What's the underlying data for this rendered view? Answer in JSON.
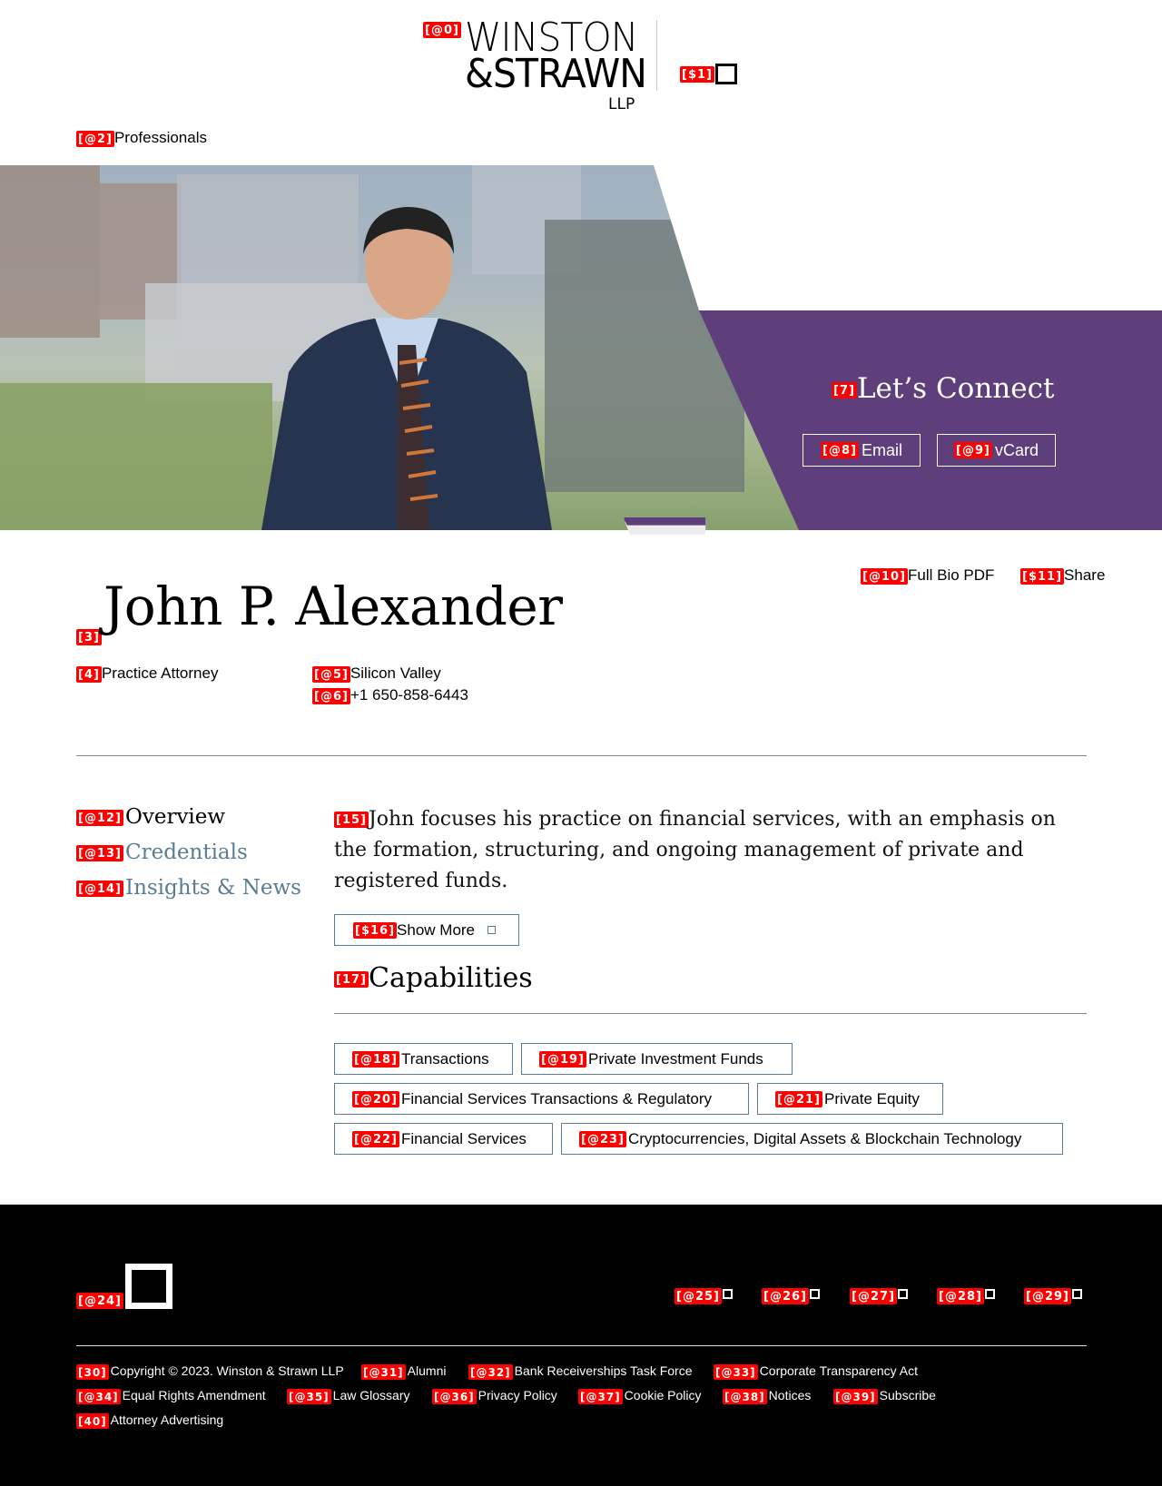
{
  "header": {
    "logo_tag": "[@0]",
    "logo_line1": "WINSTON",
    "logo_line2": "&STRAWN",
    "logo_line3": "LLP",
    "menu_tag": "[$1]"
  },
  "breadcrumb": {
    "tag": "[@2]",
    "label": "Professionals"
  },
  "connect": {
    "title_tag": "[7]",
    "title": "Let’s Connect",
    "email_tag": "[@8]",
    "email_label": "Email",
    "vcard_tag": "[@9]",
    "vcard_label": "vCard",
    "accent_color": "#5f3f7b"
  },
  "share": {
    "pdf_tag": "[@10]",
    "pdf_label": "Full Bio PDF",
    "share_tag": "[$11]",
    "share_label": "Share"
  },
  "profile": {
    "name_tag": "[3]",
    "name": "John P. Alexander",
    "title_tag": "[4]",
    "title": "Practice Attorney",
    "office_tag": "[@5]",
    "office": "Silicon Valley",
    "phone_tag": "[@6]",
    "phone": "+1 650-858-6443"
  },
  "sidenav": [
    {
      "tag": "[@12]",
      "label": "Overview"
    },
    {
      "tag": "[@13]",
      "label": "Credentials"
    },
    {
      "tag": "[@14]",
      "label": "Insights & News"
    }
  ],
  "overview": {
    "tag": "[15]",
    "text": "John focuses his practice on financial services, with an emphasis on the formation, structuring, and ongoing management of private and registered funds.",
    "show_more_tag": "[$16]",
    "show_more_label": "Show More"
  },
  "capabilities": {
    "title_tag": "[17]",
    "title": "Capabilities",
    "items": [
      {
        "tag": "[@18]",
        "label": "Transactions"
      },
      {
        "tag": "[@19]",
        "label": "Private Investment Funds"
      },
      {
        "tag": "[@20]",
        "label": "Financial Services Transactions & Regulatory"
      },
      {
        "tag": "[@21]",
        "label": "Private Equity"
      },
      {
        "tag": "[@22]",
        "label": "Financial Services"
      },
      {
        "tag": "[@23]",
        "label": "Cryptocurrencies, Digital Assets & Blockchain Technology"
      }
    ]
  },
  "footer": {
    "logo_tag": "[@24]",
    "social": [
      {
        "tag": "[@25]",
        "icon": "linkedin-icon"
      },
      {
        "tag": "[@26]",
        "icon": "twitter-icon"
      },
      {
        "tag": "[@27]",
        "icon": "facebook-icon"
      },
      {
        "tag": "[@28]",
        "icon": "instagram-icon"
      },
      {
        "tag": "[@29]",
        "icon": "youtube-icon"
      }
    ],
    "links": [
      {
        "tag": "[30]",
        "label": "Copyright © 2023. Winston & Strawn LLP"
      },
      {
        "tag": "[@31]",
        "label": "Alumni"
      },
      {
        "tag": "[@32]",
        "label": "Bank Receiverships Task Force"
      },
      {
        "tag": "[@33]",
        "label": "Corporate Transparency Act"
      },
      {
        "tag": "[@34]",
        "label": "Equal Rights Amendment"
      },
      {
        "tag": "[@35]",
        "label": "Law Glossary"
      },
      {
        "tag": "[@36]",
        "label": "Privacy Policy"
      },
      {
        "tag": "[@37]",
        "label": "Cookie Policy"
      },
      {
        "tag": "[@38]",
        "label": "Notices"
      },
      {
        "tag": "[@39]",
        "label": "Subscribe"
      },
      {
        "tag": "[40]",
        "label": "Attorney Advertising"
      }
    ]
  }
}
